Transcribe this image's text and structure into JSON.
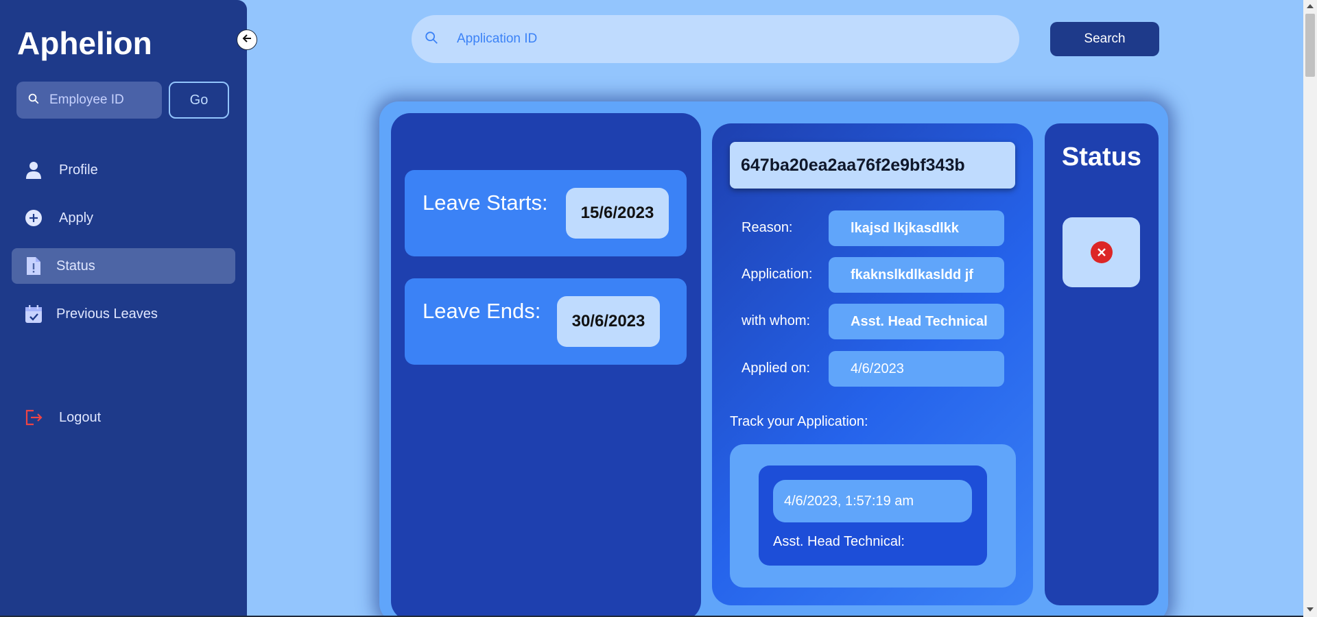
{
  "sidebar": {
    "brand": "Aphelion",
    "employee_search_placeholder": "Employee ID",
    "go_label": "Go",
    "items": [
      {
        "label": "Profile",
        "icon": "user-icon"
      },
      {
        "label": "Apply",
        "icon": "plus-circle-icon"
      },
      {
        "label": "Status",
        "icon": "file-alert-icon",
        "active": true
      },
      {
        "label": "Previous Leaves",
        "icon": "calendar-check-icon"
      }
    ],
    "logout_label": "Logout"
  },
  "header": {
    "search_placeholder": "Application ID",
    "search_button": "Search"
  },
  "leave": {
    "start_label": "Leave Starts:",
    "start_date": "15/6/2023",
    "end_label": "Leave Ends:",
    "end_date": "30/6/2023"
  },
  "application": {
    "id": "647ba20ea2aa76f2e9bf343b",
    "fields": [
      {
        "label": "Reason:",
        "value": "lkajsd lkjkasdlkk"
      },
      {
        "label": "Application:",
        "value": "fkaknslkdlkasldd jf"
      },
      {
        "label": "with whom:",
        "value": "Asst. Head Technical"
      },
      {
        "label": "Applied on:",
        "value": "4/6/2023"
      }
    ],
    "track_label": "Track your Application:",
    "track": {
      "timestamp": "4/6/2023, 1:57:19 am",
      "approver": "Asst. Head Technical:"
    }
  },
  "status": {
    "title": "Status",
    "state_icon": "reject-icon",
    "state_color": "#dc2626"
  },
  "colors": {
    "page_bg": "#93c5fd",
    "sidebar_bg": "#1e3a8a",
    "card_bg": "#60a5fa",
    "panel_dark": "#1e40af",
    "pill_light": "#bfdbfe"
  }
}
